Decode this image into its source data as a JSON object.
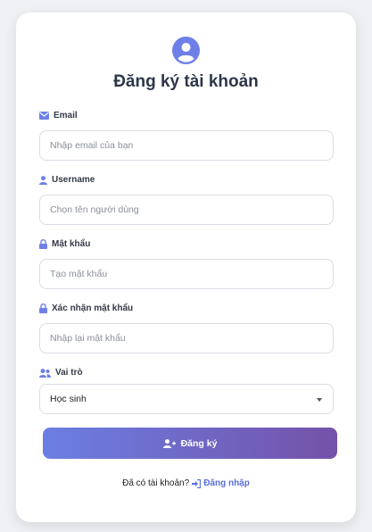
{
  "form": {
    "title": "Đăng ký tài khoản",
    "fields": [
      {
        "label": "Email",
        "placeholder": "Nhập email của bạn",
        "icon": "envelope-icon"
      },
      {
        "label": "Username",
        "placeholder": "Chọn tên người dùng",
        "icon": "user-icon"
      },
      {
        "label": "Mật khẩu",
        "placeholder": "Tạo mật khẩu",
        "icon": "lock-icon"
      },
      {
        "label": "Xác nhận mật khẩu",
        "placeholder": "Nhập lại mật khẩu",
        "icon": "lock-icon"
      }
    ],
    "role": {
      "label": "Vai trò",
      "selected": "Học sinh",
      "icon": "users-icon"
    },
    "submit_label": "Đăng ký",
    "footer_text": "Đã có tài khoản?",
    "login_link": "Đăng nhập"
  },
  "colors": {
    "accent": "#6e80e8",
    "gradient_start": "#6b7fe3",
    "gradient_end": "#7452a8",
    "link": "#5b6fd8"
  }
}
